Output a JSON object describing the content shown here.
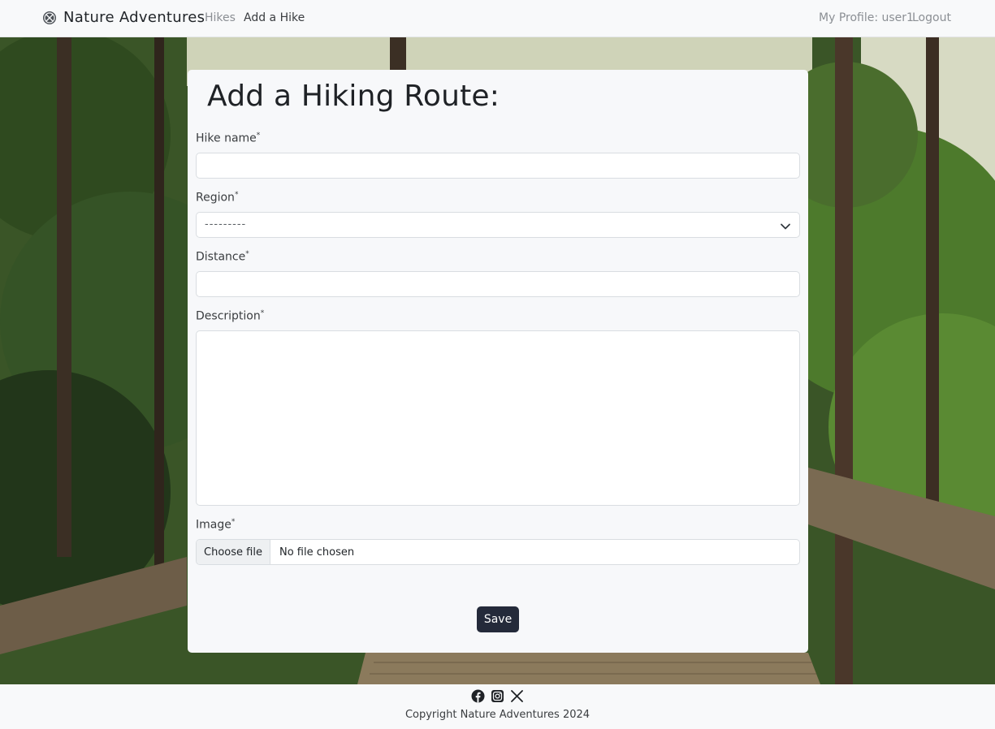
{
  "navbar": {
    "brand": "Nature Adventures",
    "links": {
      "hikes": "Hikes",
      "add_hike": "Add a Hike",
      "profile": "My Profile: user1",
      "logout": "Logout"
    }
  },
  "form": {
    "title": "Add a Hiking Route:",
    "fields": {
      "hike_name": {
        "label": "Hike name",
        "required_mark": "*",
        "value": ""
      },
      "region": {
        "label": "Region",
        "required_mark": "*",
        "selected": "---------"
      },
      "distance": {
        "label": "Distance",
        "required_mark": "*",
        "value": ""
      },
      "description": {
        "label": "Description",
        "required_mark": "*",
        "value": ""
      },
      "image": {
        "label": "Image",
        "required_mark": "*",
        "button": "Choose file",
        "status": "No file chosen"
      }
    },
    "save_label": "Save"
  },
  "footer": {
    "icons": [
      "facebook-icon",
      "instagram-icon",
      "x-icon"
    ],
    "copyright": "Copyright Nature Adventures 2024"
  },
  "colors": {
    "button": "#242a3a",
    "card": "#f7f8fa",
    "navbar": "#f8f9fa"
  }
}
